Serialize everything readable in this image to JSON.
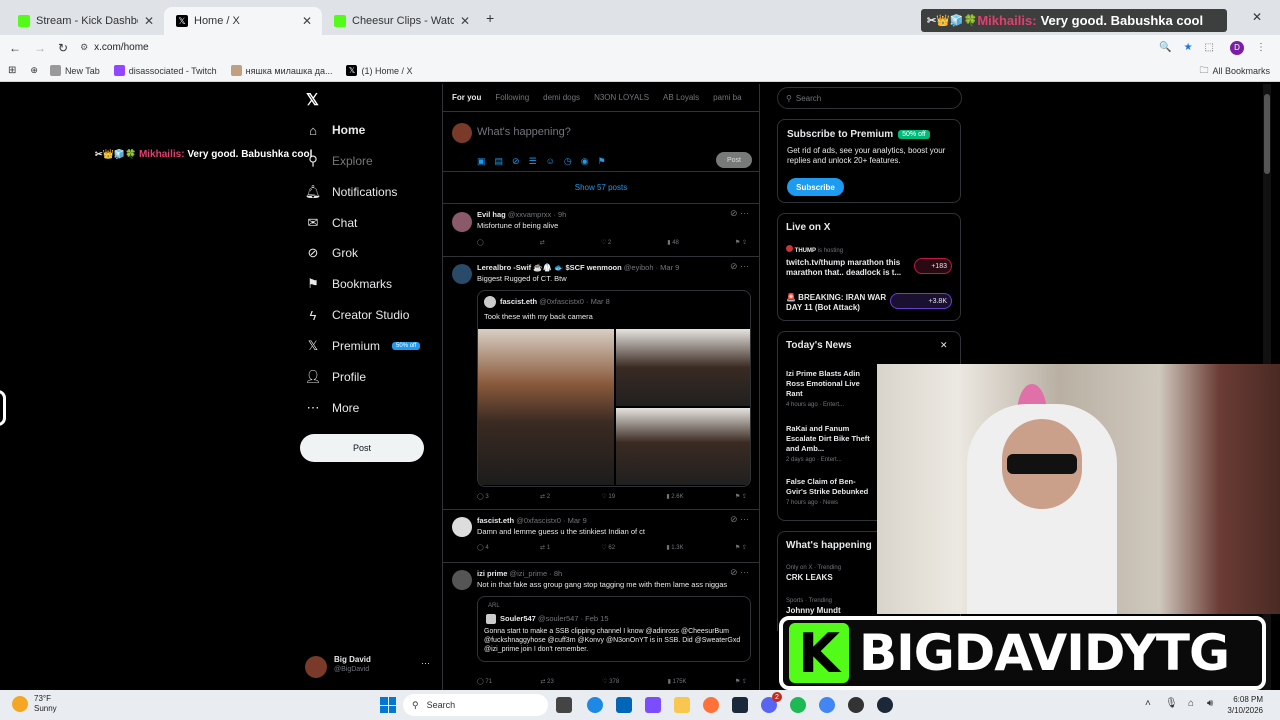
{
  "browser": {
    "tabs": [
      {
        "title": "Stream - Kick Dashboard",
        "color": "#53fc18"
      },
      {
        "title": "Home / X",
        "color": "#000000"
      },
      {
        "title": "Cheesur Clips - Watch Live on K",
        "color": "#53fc18"
      }
    ],
    "new_tab": "+",
    "window_close": "✕",
    "url": "x.com/home",
    "profile_initial": "D",
    "bookmarks": [
      "New Tab",
      "disassociated - Twitch",
      "няшка милашка да...",
      "(1) Home / X"
    ],
    "all_bookmarks": "All Bookmarks"
  },
  "chat_overlay": {
    "emotes": "✂👑🧊🍀",
    "user": "Mikhailis:",
    "message": "Very good. Babushka cool"
  },
  "nav": {
    "home": "Home",
    "explore": "Explore",
    "notifications": "Notifications",
    "chat": "Chat",
    "grok": "Grok",
    "bookmarks": "Bookmarks",
    "creator_studio": "Creator Studio",
    "premium": "Premium",
    "premium_badge": "50% off",
    "profile": "Profile",
    "more": "More",
    "post_button": "Post",
    "account_name": "Big David",
    "account_handle": "@BigDavid",
    "account_more": "···"
  },
  "timeline": {
    "tabs": [
      "For you",
      "Following",
      "demi dogs",
      "N3ON LOYALS",
      "AB Loyals",
      "pami ba"
    ],
    "compose_placeholder": "What's happening?",
    "compose_post": "Post",
    "show_posts": "Show 57 posts",
    "posts": [
      {
        "name": "Evil hag",
        "meta": "@xxvamprxx · 9h",
        "text": "Misfortune of being alive",
        "replies": "",
        "reposts": "",
        "likes": "2",
        "views": "48"
      },
      {
        "name": "Lerealbro -Swif ☕🥼 🐟 $SCF wenmoon",
        "meta": "@eyiboh · Mar 9",
        "text": "Biggest Rugged of CT. Btw",
        "quote": {
          "name": "fascist.eth",
          "meta": "@0xfascistx0 · Mar 8",
          "text": "Took these with my back camera"
        },
        "replies": "3",
        "reposts": "2",
        "likes": "19",
        "views": "2.6K"
      },
      {
        "name": "fascist.eth",
        "meta": "@0xfascistx0 · Mar 9",
        "text": "Damn and lemme guess u the stinkiest Indian of ct",
        "replies": "4",
        "reposts": "1",
        "likes": "62",
        "views": "1.3K"
      },
      {
        "name": "izi prime",
        "meta": "@izi_prime · 8h",
        "text": "Not in that fake ass group gang stop tagging me with them lame ass niggas",
        "quote": {
          "tag": "ARL",
          "name": "Souler547",
          "meta": "@souler547 · Feb 15",
          "text": "Gonna start to make a SSB clipping channel I know @adinross @CheesurBum @fuckshnaggyhose @cuff3m @Konvy @N3onOnYT is in SSB. Did @SweaterGxd @izi_prime join I don't remember."
        },
        "replies": "71",
        "reposts": "23",
        "likes": "378",
        "views": "175K"
      }
    ]
  },
  "sidebar": {
    "search_placeholder": "Search",
    "premium": {
      "title": "Subscribe to Premium",
      "badge": "50% off",
      "text": "Get rid of ads, see your analytics, boost your replies and unlock 20+ features.",
      "button": "Subscribe"
    },
    "live": {
      "title": "Live on X",
      "items": [
        {
          "host": "THUMP",
          "status": "is hosting",
          "title": "twitch.tv/thump marathon this marathon that.. deadlock is t...",
          "count": "+183"
        },
        {
          "host": "",
          "status": "",
          "title": "🚨 BREAKING: IRAN WAR DAY 11 (Bot Attack)",
          "count": "+3.8K"
        }
      ]
    },
    "news": {
      "title": "Today's News",
      "close": "✕",
      "items": [
        {
          "headline": "Izi Prime Blasts Adin Ross Emotional Live Rant",
          "meta": "4 hours ago · Entert..."
        },
        {
          "headline": "RaKai and Fanum Escalate Dirt Bike Theft and Amb...",
          "meta": "2 days ago · Entert..."
        },
        {
          "headline": "False Claim of Ben-Gvir's Strike Debunked",
          "meta": "7 hours ago · News"
        }
      ]
    },
    "happening": {
      "title": "What's happening",
      "items": [
        {
          "context": "Only on X · Trending",
          "topic": "CRK LEAKS"
        },
        {
          "context": "Sports · Trending",
          "topic": "Johnny Mundt"
        }
      ]
    }
  },
  "stream_overlay": {
    "brand": "BIGDAVIDYTG",
    "logo": "K"
  },
  "taskbar": {
    "weather_temp": "73°F",
    "weather_desc": "Sunny",
    "search": "Search",
    "notif_count": "2",
    "time": "6:08 PM",
    "date": "3/10/2026"
  }
}
